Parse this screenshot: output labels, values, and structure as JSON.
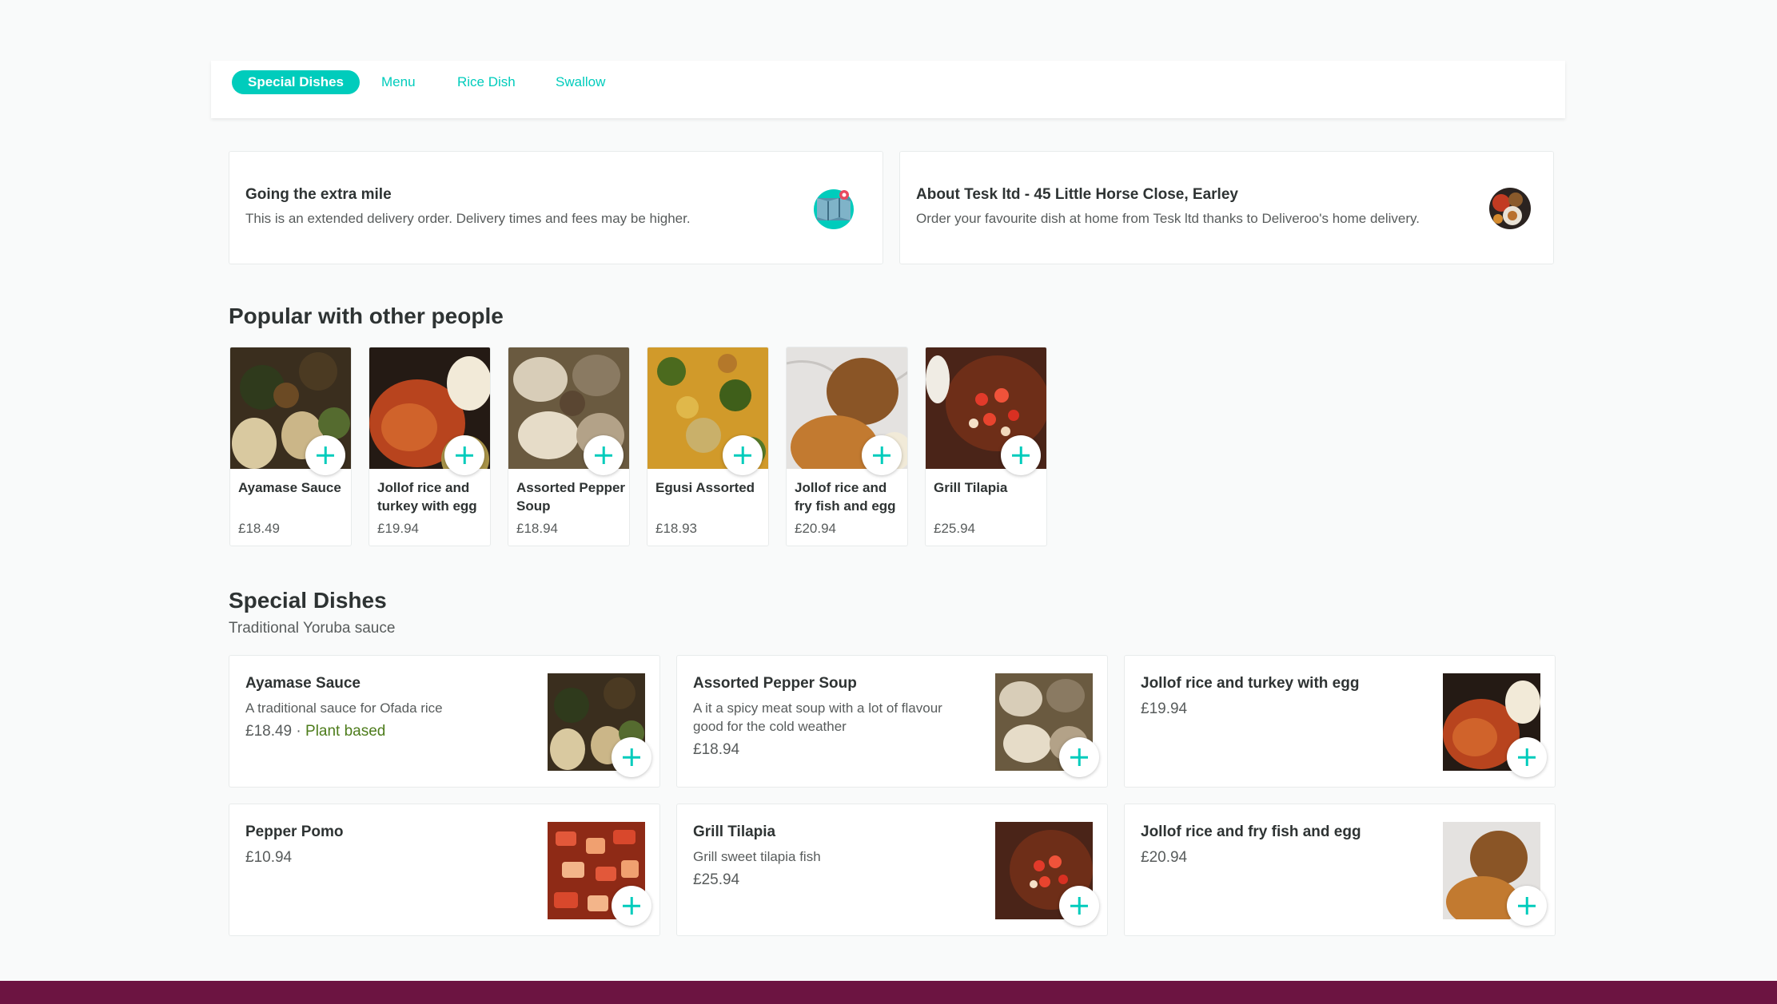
{
  "tabs": [
    {
      "label": "Special Dishes",
      "active": true
    },
    {
      "label": "Menu",
      "active": false
    },
    {
      "label": "Rice Dish",
      "active": false
    },
    {
      "label": "Swallow",
      "active": false
    }
  ],
  "info": {
    "delivery": {
      "title": "Going the extra mile",
      "text": "This is an extended delivery order. Delivery times and fees may be higher.",
      "icon": "map-pin-icon"
    },
    "about": {
      "title": "About Tesk ltd - 45 Little Horse Close, Earley",
      "text": "Order your favourite dish at home from Tesk ltd thanks to Deliveroo's home delivery.",
      "icon": "restaurant-avatar"
    }
  },
  "popular": {
    "heading": "Popular with other people",
    "items": [
      {
        "name": "Ayamase Sauce",
        "price": "£18.49"
      },
      {
        "name": "Jollof rice and turkey with egg",
        "price": "£19.94"
      },
      {
        "name": "Assorted Pepper Soup",
        "price": "£18.94"
      },
      {
        "name": "Egusi Assorted",
        "price": "£18.93"
      },
      {
        "name": "Jollof rice and fry fish and egg",
        "price": "£20.94"
      },
      {
        "name": "Grill Tilapia",
        "price": "£25.94"
      }
    ]
  },
  "special": {
    "heading": "Special Dishes",
    "subheading": "Traditional Yoruba sauce",
    "items": [
      {
        "name": "Ayamase Sauce",
        "desc": "A traditional sauce for Ofada rice",
        "price": "£18.49",
        "tag": "Plant based"
      },
      {
        "name": "Assorted Pepper Soup",
        "desc": "A it a spicy meat soup with a lot of flavour good for the cold weather",
        "price": "£18.94"
      },
      {
        "name": "Jollof rice and turkey with egg",
        "desc": "",
        "price": "£19.94"
      },
      {
        "name": "Pepper Pomo",
        "desc": "",
        "price": "£10.94"
      },
      {
        "name": "Grill Tilapia",
        "desc": "Grill sweet tilapia fish",
        "price": "£25.94"
      },
      {
        "name": "Jollof rice and fry fish and egg",
        "desc": "",
        "price": "£20.94"
      }
    ]
  },
  "colors": {
    "accent": "#00ccbc",
    "footer": "#6c1441",
    "tag": "#4d7c1b"
  }
}
